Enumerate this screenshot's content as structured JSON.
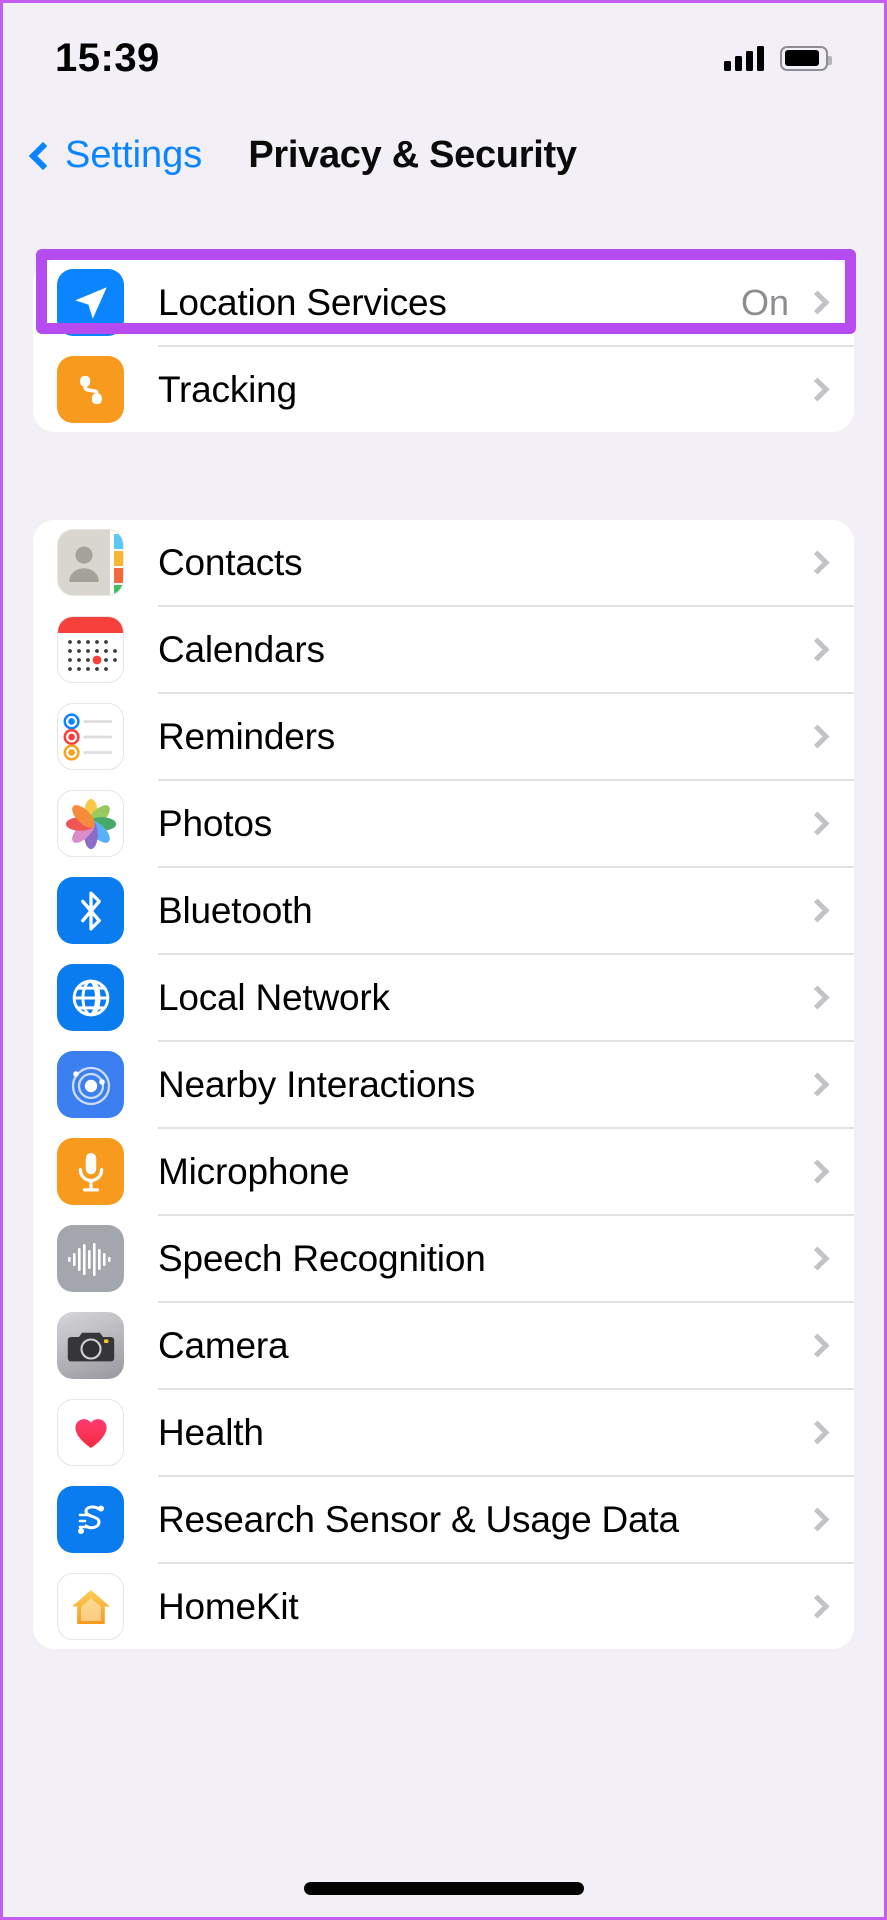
{
  "status_bar": {
    "time": "15:39",
    "signal_icon": "cellular-bars-icon",
    "battery_icon": "battery-icon"
  },
  "nav_bar": {
    "back_label": "Settings",
    "back_icon": "chevron-left-icon",
    "title": "Privacy & Security"
  },
  "colors": {
    "accent_blue": "#0a84ff",
    "highlight_purple": "#b64cf0",
    "page_background": "#f2f0f6",
    "card_background": "#ffffff",
    "separator": "#e2e2e6",
    "secondary_text": "#8c8c91",
    "chevron": "#c3c3c7"
  },
  "sections": [
    {
      "name": "location-and-tracking",
      "rows": [
        {
          "label": "Location Services",
          "value": "On",
          "icon": "location-arrow-icon",
          "highlighted": true
        },
        {
          "label": "Tracking",
          "value": "",
          "icon": "tracking-icon",
          "highlighted": false
        }
      ]
    },
    {
      "name": "app-privacy-permissions",
      "rows": [
        {
          "label": "Contacts",
          "value": "",
          "icon": "contacts-icon"
        },
        {
          "label": "Calendars",
          "value": "",
          "icon": "calendar-icon"
        },
        {
          "label": "Reminders",
          "value": "",
          "icon": "reminders-icon"
        },
        {
          "label": "Photos",
          "value": "",
          "icon": "photos-icon"
        },
        {
          "label": "Bluetooth",
          "value": "",
          "icon": "bluetooth-icon"
        },
        {
          "label": "Local Network",
          "value": "",
          "icon": "globe-icon"
        },
        {
          "label": "Nearby Interactions",
          "value": "",
          "icon": "nearby-interactions-icon"
        },
        {
          "label": "Microphone",
          "value": "",
          "icon": "microphone-icon"
        },
        {
          "label": "Speech Recognition",
          "value": "",
          "icon": "waveform-icon"
        },
        {
          "label": "Camera",
          "value": "",
          "icon": "camera-icon"
        },
        {
          "label": "Health",
          "value": "",
          "icon": "heart-icon"
        },
        {
          "label": "Research Sensor & Usage Data",
          "value": "",
          "icon": "research-sensor-icon"
        },
        {
          "label": "HomeKit",
          "value": "",
          "icon": "home-icon"
        }
      ]
    }
  ],
  "home_indicator": "home-indicator-bar"
}
